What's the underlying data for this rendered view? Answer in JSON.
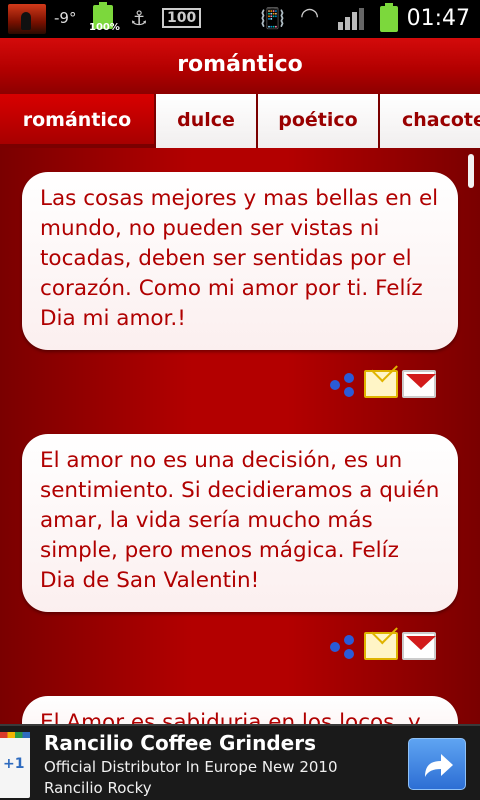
{
  "status_bar": {
    "temperature": "-9°",
    "battery_percent": "100%",
    "storage_badge": "100",
    "time": "01:47"
  },
  "title_bar": {
    "title": "romántico"
  },
  "tabs": [
    {
      "label": "romántico",
      "active": true
    },
    {
      "label": "dulce",
      "active": false
    },
    {
      "label": "poético",
      "active": false
    },
    {
      "label": "chacote",
      "active": false
    }
  ],
  "messages": [
    {
      "text": "Las cosas mejores y mas bellas en el mundo, no pueden ser vistas ni tocadas, deben ser sentidas por el corazón. Como mi amor por ti. Felíz Dia mi amor.!",
      "actions": [
        "share-icon",
        "email-icon",
        "gmail-icon"
      ]
    },
    {
      "text": "El amor no es una decisión, es un sentimiento. Si decidieramos a quién amar, la vida sería mucho más simple, pero menos mágica. Felíz Dia de San Valentin!",
      "actions": [
        "share-icon",
        "email-icon",
        "gmail-icon"
      ]
    },
    {
      "text": "El Amor es sabiduria en los locos, y"
    }
  ],
  "ad": {
    "plus_label": "+1",
    "title": "Rancilio Coffee Grinders",
    "line1": "Official Distributor In Europe New 2010",
    "line2": "Rancilio Rocky"
  },
  "colors": {
    "accent_red": "#b30000",
    "text_red": "#b00000",
    "status_bg": "#000000",
    "ad_button_blue": "#2d6ed4"
  }
}
